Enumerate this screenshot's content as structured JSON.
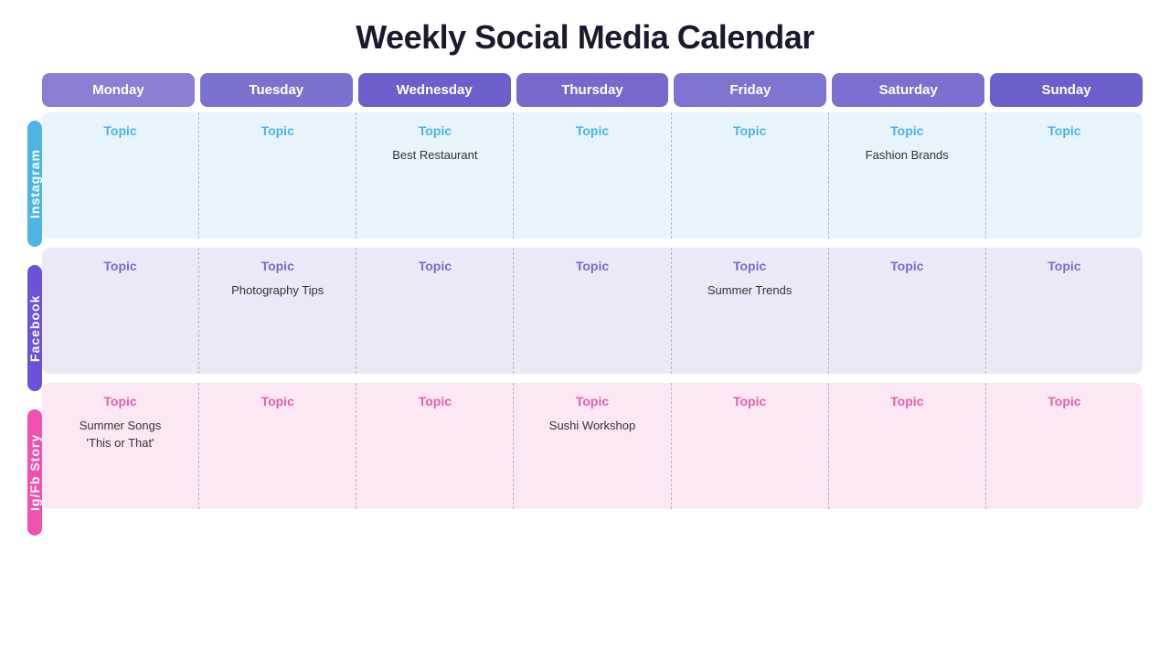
{
  "title": "Weekly Social Media Calendar",
  "days": [
    "Monday",
    "Tuesday",
    "Wednesday",
    "Thursday",
    "Friday",
    "Saturday",
    "Sunday"
  ],
  "platforms": [
    {
      "name": "Instagram",
      "color_class": "cell-instagram",
      "label_class": "label-instagram",
      "topic_class": "topic-instagram",
      "cells": [
        {
          "topic": "Topic",
          "content": ""
        },
        {
          "topic": "Topic",
          "content": ""
        },
        {
          "topic": "Topic",
          "content": "Best Restaurant"
        },
        {
          "topic": "Topic",
          "content": ""
        },
        {
          "topic": "Topic",
          "content": ""
        },
        {
          "topic": "Topic",
          "content": "Fashion Brands"
        },
        {
          "topic": "Topic",
          "content": ""
        }
      ]
    },
    {
      "name": "Facebook",
      "color_class": "cell-facebook",
      "label_class": "label-facebook",
      "topic_class": "topic-facebook",
      "cells": [
        {
          "topic": "Topic",
          "content": ""
        },
        {
          "topic": "Topic",
          "content": "Photography Tips"
        },
        {
          "topic": "Topic",
          "content": ""
        },
        {
          "topic": "Topic",
          "content": ""
        },
        {
          "topic": "Topic",
          "content": "Summer Trends"
        },
        {
          "topic": "Topic",
          "content": ""
        },
        {
          "topic": "Topic",
          "content": ""
        }
      ]
    },
    {
      "name": "Ig/Fb Story",
      "color_class": "cell-story",
      "label_class": "label-igfbstory",
      "topic_class": "topic-story",
      "cells": [
        {
          "topic": "Topic",
          "content": "Summer Songs\n'This or That'"
        },
        {
          "topic": "Topic",
          "content": ""
        },
        {
          "topic": "Topic",
          "content": ""
        },
        {
          "topic": "Topic",
          "content": "Sushi Workshop"
        },
        {
          "topic": "Topic",
          "content": ""
        },
        {
          "topic": "Topic",
          "content": ""
        },
        {
          "topic": "Topic",
          "content": ""
        }
      ]
    }
  ]
}
